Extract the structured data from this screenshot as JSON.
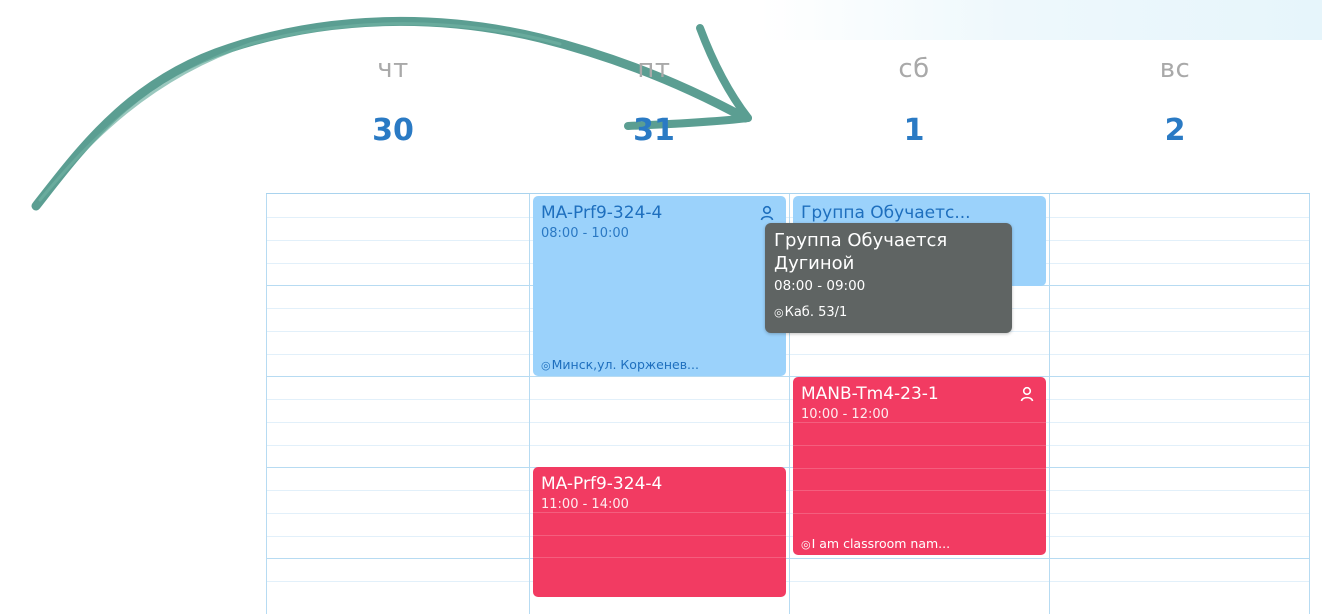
{
  "days": [
    {
      "name": "чт",
      "number": "30"
    },
    {
      "name": "пт",
      "number": "31"
    },
    {
      "name": "сб",
      "number": "1"
    },
    {
      "name": "вс",
      "number": "2"
    }
  ],
  "events": [
    {
      "id": "fri-morning",
      "title": "MA-Prf9-324-4",
      "time": "08:00 - 10:00",
      "location": "Минск,ул. Корженев...",
      "color": "#9bd2fb",
      "icon": "person-icon"
    },
    {
      "id": "sat-group",
      "title": "Группа Обучаетс...",
      "color": "#9bd2fb"
    },
    {
      "id": "sat-manb",
      "title": "MANB-Tm4-23-1",
      "time": "10:00 - 12:00",
      "location": "I am classroom nam...",
      "color": "#f23b62",
      "icon": "person-icon"
    },
    {
      "id": "fri-midday",
      "title": "MA-Prf9-324-4",
      "time": "11:00 - 14:00",
      "color": "#f23b62"
    }
  ],
  "tooltip": {
    "title": "Группа Обучается Дугиной",
    "time": "08:00 - 09:00",
    "location": "Каб. 53/1",
    "color": "#5f6463"
  },
  "colors": {
    "accent": "#2a7ac4",
    "arrow": "#5b9e92",
    "day_name": "#a9a9a9",
    "grid_line": "#b7dbf2"
  }
}
